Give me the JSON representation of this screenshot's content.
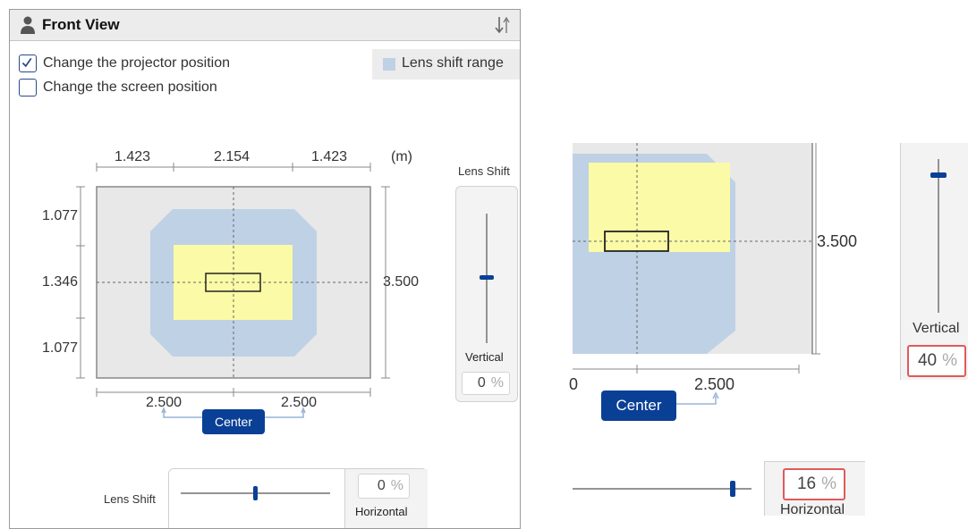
{
  "panel": {
    "title": "Front View",
    "checkbox_projector": {
      "label": "Change the projector position",
      "checked": true
    },
    "checkbox_screen": {
      "label": "Change the screen position",
      "checked": false
    },
    "legend_label": "Lens shift range",
    "unit": "(m)",
    "top_dims": [
      "1.423",
      "2.154",
      "1.423"
    ],
    "left_dims": [
      "1.077",
      "1.346",
      "1.077"
    ],
    "height_dim": "3.500",
    "bottom_dims": [
      "2.500",
      "2.500"
    ],
    "center_button": "Center",
    "vertical_slider": {
      "title": "Lens Shift",
      "label": "Vertical",
      "value": "0",
      "unit": "%"
    },
    "horizontal_slider": {
      "title": "Lens Shift",
      "label": "Horizontal",
      "value": "0",
      "unit": "%"
    }
  },
  "zoom": {
    "height_dim": "3.500",
    "bottom_dim_left": "0",
    "bottom_dim_right": "2.500",
    "center_button": "Center",
    "vertical_slider": {
      "label": "Vertical",
      "value": "40",
      "unit": "%"
    },
    "horizontal_slider": {
      "label": "Horizontal",
      "value": "16",
      "unit": "%"
    }
  },
  "colors": {
    "lens_range": "#bfd1e5",
    "projection": "#fbfaa6",
    "screen_bg": "#e8e8e8",
    "accent": "#0a3f96",
    "highlight_border": "#e05a5a"
  }
}
